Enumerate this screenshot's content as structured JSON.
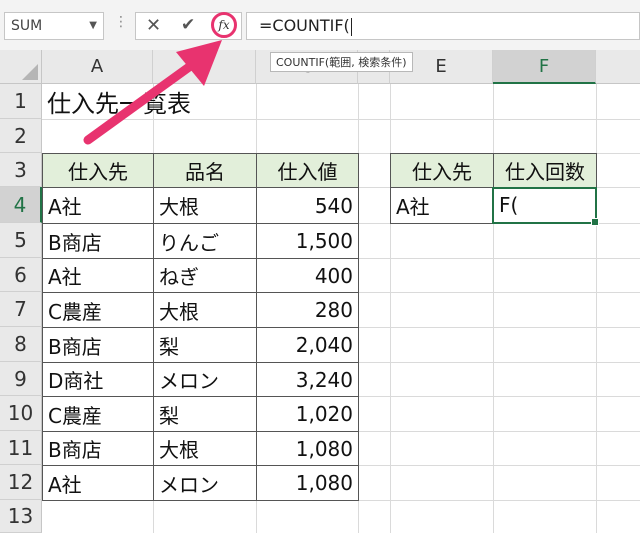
{
  "name_box": {
    "value": "SUM"
  },
  "formula_bar": {
    "cancel_glyph": "✕",
    "enter_glyph": "✔",
    "fx_label": "fx",
    "formula": "=COUNTIF("
  },
  "tooltip": {
    "text": "COUNTIF(範囲, 検索条件)"
  },
  "columns": [
    "A",
    "B",
    "C",
    "D",
    "E",
    "F"
  ],
  "rows": [
    "1",
    "2",
    "3",
    "4",
    "5",
    "6",
    "7",
    "8",
    "9",
    "10",
    "11",
    "12",
    "13"
  ],
  "sheet": {
    "title": "仕入先一覧表",
    "headers": [
      "仕入先",
      "品名",
      "仕入値"
    ],
    "records": [
      [
        "A社",
        "大根",
        "540"
      ],
      [
        "B商店",
        "りんご",
        "1,500"
      ],
      [
        "A社",
        "ねぎ",
        "400"
      ],
      [
        "C農産",
        "大根",
        "280"
      ],
      [
        "B商店",
        "梨",
        "2,040"
      ],
      [
        "D商社",
        "メロン",
        "3,240"
      ],
      [
        "C農産",
        "梨",
        "1,020"
      ],
      [
        "B商店",
        "大根",
        "1,080"
      ],
      [
        "A社",
        "メロン",
        "1,080"
      ]
    ],
    "summary_headers": [
      "仕入先",
      "仕入回数"
    ],
    "summary_value": "A社",
    "editing_text": "F("
  },
  "colors": {
    "accent": "#217346",
    "highlight": "#e8336f",
    "header_fill": "#e2efda"
  }
}
